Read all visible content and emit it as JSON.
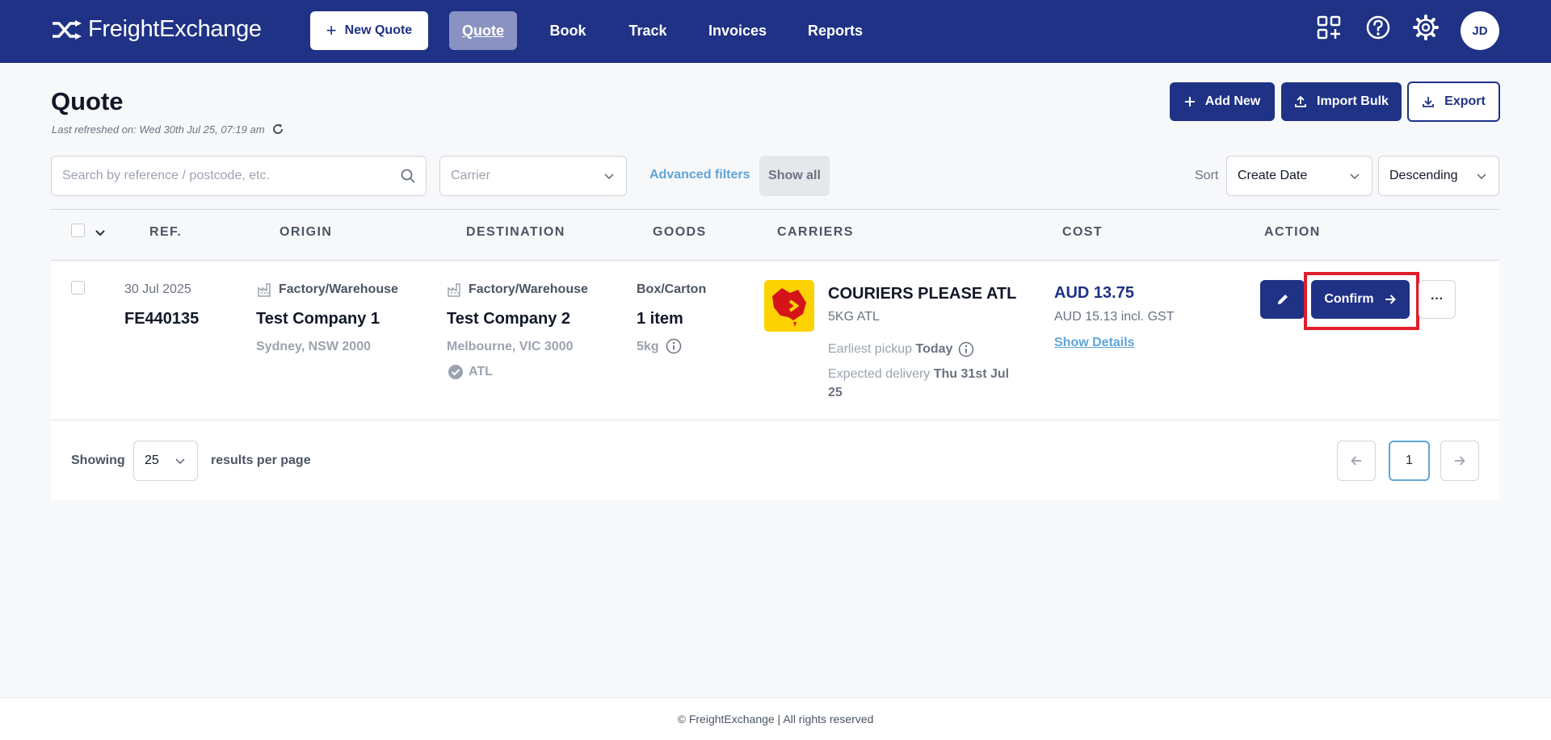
{
  "app": {
    "name": "FreightExchange",
    "brand_color": "#1f3285"
  },
  "nav": {
    "new_quote": "New Quote",
    "items": [
      "Quote",
      "Book",
      "Track",
      "Invoices",
      "Reports"
    ],
    "active": "Quote",
    "avatar_initials": "JD"
  },
  "header": {
    "title": "Quote",
    "last_refreshed": "Last refreshed on: Wed 30th Jul 25, 07:19 am",
    "add_new": "Add New",
    "import_bulk": "Import Bulk",
    "export": "Export"
  },
  "filters": {
    "search_placeholder": "Search by reference / postcode, etc.",
    "carrier_placeholder": "Carrier",
    "advanced_filters": "Advanced filters",
    "show_all": "Show all",
    "sort_label": "Sort",
    "sort_field": "Create Date",
    "sort_order": "Descending"
  },
  "table": {
    "columns": [
      "REF.",
      "ORIGIN",
      "DESTINATION",
      "GOODS",
      "CARRIERS",
      "COST",
      "ACTION"
    ],
    "rows": [
      {
        "date": "30 Jul 2025",
        "ref": "FE440135",
        "origin_type": "Factory/Warehouse",
        "origin_company": "Test Company 1",
        "origin_location": "Sydney, NSW 2000",
        "dest_type": "Factory/Warehouse",
        "dest_company": "Test Company 2",
        "dest_location": "Melbourne, VIC 3000",
        "dest_tag": "ATL",
        "goods_type": "Box/Carton",
        "goods_count": "1 item",
        "goods_weight": "5kg",
        "carrier_name": "COURIERS PLEASE ATL",
        "carrier_service": "5KG ATL",
        "pickup_label": "Earliest pickup",
        "pickup_value": "Today",
        "delivery_label": "Expected delivery",
        "delivery_value": "Thu 31st Jul 25",
        "cost": "AUD 13.75",
        "cost_incl": "AUD 15.13 incl. GST",
        "show_details": "Show Details",
        "confirm": "Confirm",
        "more": "···"
      }
    ]
  },
  "pagination": {
    "showing": "Showing",
    "per_page": "25",
    "per_page_suffix": "results per page",
    "current_page": "1"
  },
  "footer": {
    "text": "© FreightExchange | All rights reserved"
  }
}
